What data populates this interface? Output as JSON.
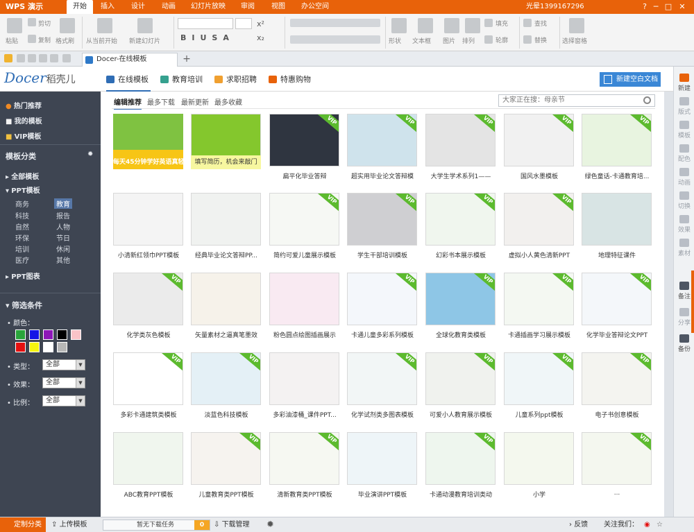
{
  "app": {
    "name": "WPS 演示",
    "account": "光晕1399167296"
  },
  "menu_tabs": [
    "开始",
    "插入",
    "设计",
    "动画",
    "幻灯片放映",
    "审阅",
    "视图",
    "办公空间"
  ],
  "window_buttons": [
    "?",
    "─",
    "□",
    "✕"
  ],
  "ribbon": {
    "paste": "粘贴",
    "cut": "剪切",
    "copy": "复制",
    "format_painter": "格式刷",
    "from_current": "从当前开始",
    "new_slide": "新建幻灯片",
    "text_box": "文本框",
    "shape": "形状",
    "picture": "图片",
    "arrange": "排列",
    "fill": "填充",
    "outline": "轮廓",
    "find": "查找",
    "replace": "替换",
    "selection_pane": "选择窗格",
    "font_buttons": [
      "B",
      "I",
      "U",
      "S",
      "A",
      "x²",
      "x₂"
    ]
  },
  "doc_tab": {
    "title": "Docer-在线模板"
  },
  "docer": {
    "logo": "Docer",
    "logo_cn": "稻壳儿",
    "nav_tabs": [
      "在线模板",
      "教育培训",
      "求职招聘",
      "特惠购物"
    ],
    "new_blank": "新建空白文档"
  },
  "sidebar": {
    "hot": "热门推荐",
    "mine": "我的模板",
    "vip": "VIP模板",
    "categories_title": "模板分类",
    "all_templates": "全部模板",
    "ppt_templates": "PPT模板",
    "ppt_cats": [
      "商务",
      "教育",
      "科技",
      "报告",
      "自然",
      "人物",
      "环保",
      "节日",
      "培训",
      "休闲",
      "医疗",
      "其他"
    ],
    "ppt_charts": "PPT图表",
    "filter_title": "筛选条件",
    "color_label": "颜色：",
    "colors": [
      "#2aa43b",
      "#1515e6",
      "#8e17b8",
      "#000000",
      "#f9c3c8",
      "#e41010",
      "#f5f510",
      "#ffffff",
      "#b7b7b7"
    ],
    "type_label": "类型：",
    "effect_label": "效果：",
    "ratio_label": "比例：",
    "all": "全部"
  },
  "filters": {
    "tabs": [
      "编辑推荐",
      "最多下载",
      "最新更新",
      "最多收藏"
    ],
    "search_placeholder": "大家正在搜：母亲节"
  },
  "templates": [
    [
      "每天45分钟学好英语真轻松",
      "填写简历，机会来敲门",
      "扁平化毕业答辩",
      "超实用毕业论文答辩模",
      "大学生学术系列1——",
      "国风水墨模板",
      "绿色童话-卡通教育培..."
    ],
    [
      "小清新红领巾PPT模板",
      "经典毕业论文答辩PP...",
      "简约可爱儿童展示模板",
      "学生干部培训模板",
      "幻彩书本展示模板",
      "虚拟小人黄色清新PPT",
      "地理特征课件"
    ],
    [
      "化学类灰色模板",
      "矢量素材之逼真笔墨效",
      "粉色圆点绘图插画展示",
      "卡通儿童多彩系列模板",
      "全球化教育类模板",
      "卡通插画学习展示模板",
      "化学毕业答辩论文PPT"
    ],
    [
      "多彩卡通建筑类模板",
      "淡蓝色科技模板",
      "多彩油漆桶_课件PPT...",
      "化学试剂类多图表模板",
      "可爱小人教育展示模板",
      "儿童系列ppt模板",
      "电子书创意模板"
    ],
    [
      "ABC教育PPT模板",
      "儿童教育类PPT模板",
      "清新教育类PPT模板",
      "毕业演讲PPT模板",
      "卡通动漫教育培训类动",
      "小学",
      "..."
    ]
  ],
  "right_tools": [
    "新建",
    "版式",
    "模板",
    "配色",
    "动画",
    "切换",
    "效果",
    "素材",
    "备注",
    "分享",
    "备份"
  ],
  "status": {
    "custom": "定制分类",
    "upload": "上传模板",
    "no_download": "暂无下载任务",
    "count": "0",
    "download_manage": "下载管理",
    "feedback": "反馈",
    "follow": "关注我们："
  }
}
